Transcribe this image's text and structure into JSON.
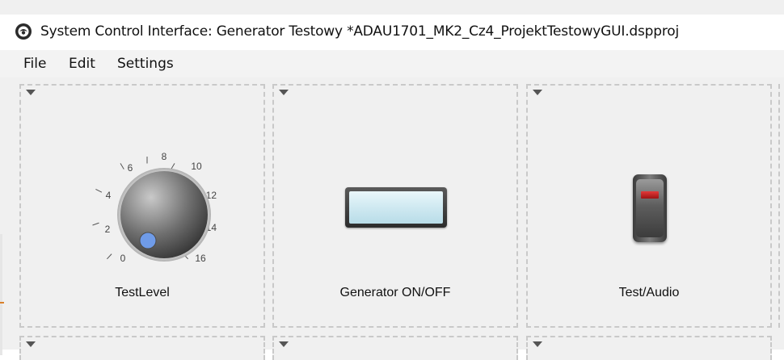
{
  "window": {
    "title": "System Control Interface: Generator Testowy *ADAU1701_MK2_Cz4_ProjektTestowyGUI.dspproj",
    "app_icon": "sigmastudio-logo-icon"
  },
  "menu": {
    "items": [
      {
        "label": "File"
      },
      {
        "label": "Edit"
      },
      {
        "label": "Settings"
      }
    ]
  },
  "controls": {
    "knob": {
      "label": "TestLevel",
      "scale_labels": [
        "0",
        "2",
        "4",
        "6",
        "8",
        "10",
        "12",
        "14",
        "16"
      ],
      "indicator_color": "#6f9be8"
    },
    "button": {
      "label": "Generator ON/OFF",
      "face_color": "#cfe9f1"
    },
    "switch": {
      "label": "Test/Audio",
      "indicator_color": "#c21f1f"
    }
  },
  "colors": {
    "panel_border": "#c9c9c9",
    "background": "#f0f0f0"
  }
}
